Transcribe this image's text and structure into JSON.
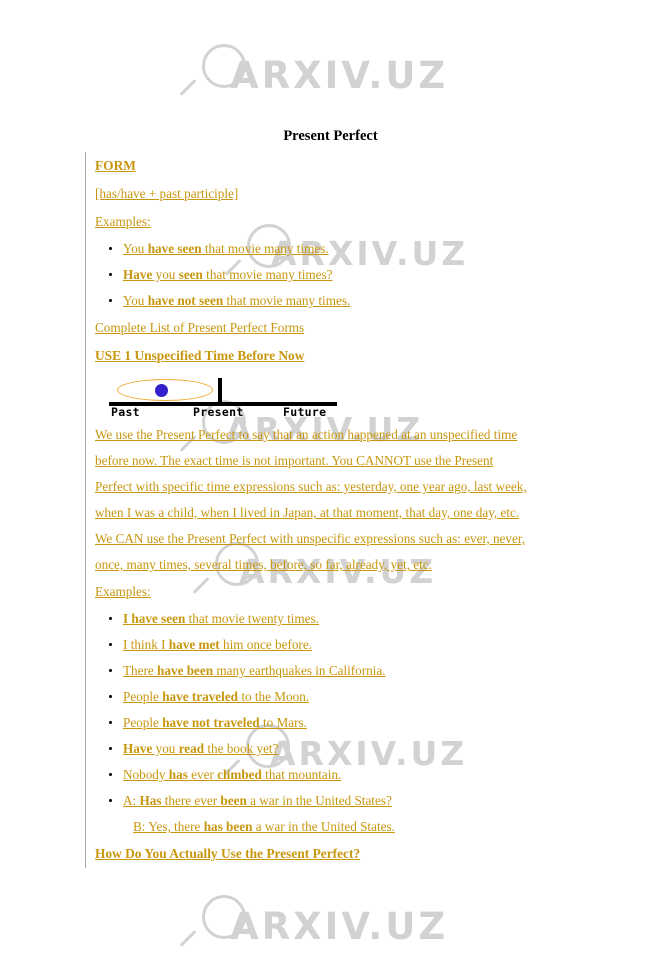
{
  "watermark": {
    "text": "ARXIV.UZ",
    "icon": "magnifier-icon",
    "color": "#d2d2d2"
  },
  "document": {
    "title": "Present Perfect",
    "title_color": "#000000",
    "link_color": "#c8970f",
    "sections": {
      "form_heading": "FORM",
      "formula": "[has/have + past participle]",
      "examples_label_1": "Examples:",
      "complete_list_link": "Complete List of Present Perfect Forms",
      "use1_heading": "USE 1 Unspecified Time Before Now",
      "examples_label_2": "Examples:",
      "closing_heading": "How Do You Actually Use the Present Perfect?"
    },
    "form_examples": [
      {
        "pre": "You ",
        "bold1": "have seen",
        "post": " that movie many times.",
        "bold2": "",
        "post2": ""
      },
      {
        "pre": "",
        "bold1": "Have",
        "post": " you ",
        "bold2": "seen",
        "post2": " that movie many times?"
      },
      {
        "pre": "You ",
        "bold1": "have not seen",
        "post": " that movie many times.",
        "bold2": "",
        "post2": ""
      }
    ],
    "timeline": {
      "past_label": "Past",
      "present_label": "Present",
      "future_label": "Future",
      "oval_color": "#f0a830",
      "marker_color": "#3322cc",
      "axis_color": "#000000"
    },
    "use1_paragraph": [
      "We use the Present Perfect to say that an action happened at an unspecified time ",
      "before now. The exact time is not important. You CANNOT use the Present ",
      "Perfect with specific time expressions such as: yesterday, one year ago, last week, ",
      "when I was a child, when I lived in Japan, at that moment, that day, one day, etc. ",
      "We CAN use the Present Perfect with unspecific expressions such as: ever, never, ",
      "once, many times, several times, before, so far, already, yet, etc."
    ],
    "use1_examples": [
      {
        "pre": "",
        "bold1": "I have seen",
        "post": " that movie twenty times.",
        "bold2": "",
        "post2": "",
        "sub": ""
      },
      {
        "pre": "I think I ",
        "bold1": "have met",
        "post": " him once before.",
        "bold2": "",
        "post2": "",
        "sub": ""
      },
      {
        "pre": "There ",
        "bold1": "have been",
        "post": " many earthquakes in California.",
        "bold2": "",
        "post2": "",
        "sub": ""
      },
      {
        "pre": "People ",
        "bold1": "have traveled",
        "post": " to the Moon.",
        "bold2": "",
        "post2": "",
        "sub": ""
      },
      {
        "pre": "People ",
        "bold1": "have not traveled",
        "post": " to Mars.",
        "bold2": "",
        "post2": "",
        "sub": ""
      },
      {
        "pre": "",
        "bold1": "Have",
        "post": " you ",
        "bold2": "read",
        "post2": " the book yet?",
        "sub": ""
      },
      {
        "pre": "Nobody ",
        "bold1": "has",
        "post": " ever ",
        "bold2": "climbed",
        "post2": " that mountain.",
        "sub": ""
      },
      {
        "pre": "A: ",
        "bold1": "Has",
        "post": " there ever ",
        "bold2": "been",
        "post2": " a war in the United States?",
        "sub_pre": "B: Yes, there ",
        "sub_bold": "has been",
        "sub_post": " a war in the United States."
      }
    ]
  }
}
